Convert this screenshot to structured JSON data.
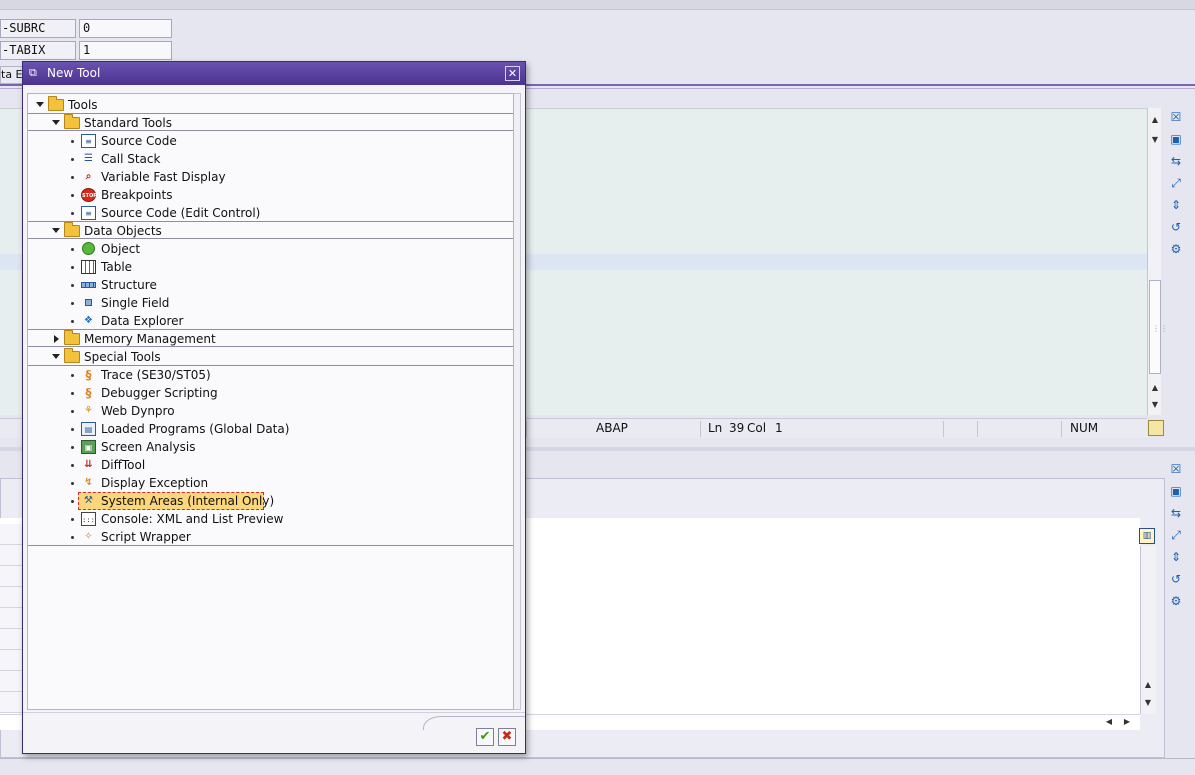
{
  "background": {
    "sysfields": [
      {
        "label": "-SUBRC",
        "value": "0"
      },
      {
        "label": "-TABIX",
        "value": "1"
      }
    ],
    "tab_stub": "ta Ex",
    "status": {
      "language": "ABAP",
      "ln_label": "Ln",
      "ln_value": "39",
      "col_label": "Col",
      "col_value": "1",
      "num": "NUM"
    },
    "side_icons": [
      "close-tool-icon",
      "new-tool-icon",
      "replace-tool-icon",
      "maximize-icon",
      "swap-icon",
      "undo-icon",
      "services-icon"
    ]
  },
  "dialog": {
    "title": "New Tool",
    "tree": {
      "root": "Tools",
      "groups": [
        {
          "label": "Standard Tools",
          "expanded": true,
          "items": [
            {
              "label": "Source Code",
              "icon": "source-code-icon"
            },
            {
              "label": "Call Stack",
              "icon": "call-stack-icon"
            },
            {
              "label": "Variable Fast Display",
              "icon": "variable-display-icon"
            },
            {
              "label": "Breakpoints",
              "icon": "stop-icon"
            },
            {
              "label": "Source Code (Edit Control)",
              "icon": "source-code-edit-icon"
            }
          ]
        },
        {
          "label": "Data Objects",
          "expanded": true,
          "items": [
            {
              "label": "Object",
              "icon": "object-icon"
            },
            {
              "label": "Table",
              "icon": "table-icon"
            },
            {
              "label": "Structure",
              "icon": "structure-icon"
            },
            {
              "label": "Single Field",
              "icon": "single-field-icon"
            },
            {
              "label": "Data Explorer",
              "icon": "data-explorer-icon"
            }
          ]
        },
        {
          "label": "Memory Management",
          "expanded": false,
          "items": []
        },
        {
          "label": "Special Tools",
          "expanded": true,
          "items": [
            {
              "label": "Trace (SE30/ST05)",
              "icon": "trace-icon"
            },
            {
              "label": "Debugger Scripting",
              "icon": "scripting-icon"
            },
            {
              "label": "Web Dynpro",
              "icon": "web-dynpro-icon"
            },
            {
              "label": "Loaded Programs (Global Data)",
              "icon": "loaded-programs-icon"
            },
            {
              "label": "Screen Analysis",
              "icon": "screen-analysis-icon"
            },
            {
              "label": "DiffTool",
              "icon": "difftool-icon"
            },
            {
              "label": "Display Exception",
              "icon": "exception-icon"
            },
            {
              "label": "System Areas (Internal Only)",
              "icon": "system-areas-icon",
              "selected": true
            },
            {
              "label": "Console: XML and List Preview",
              "icon": "console-icon"
            },
            {
              "label": "Script Wrapper",
              "icon": "script-wrapper-icon"
            }
          ]
        }
      ]
    },
    "buttons": {
      "ok": "check-icon",
      "cancel": "cancel-icon"
    }
  }
}
